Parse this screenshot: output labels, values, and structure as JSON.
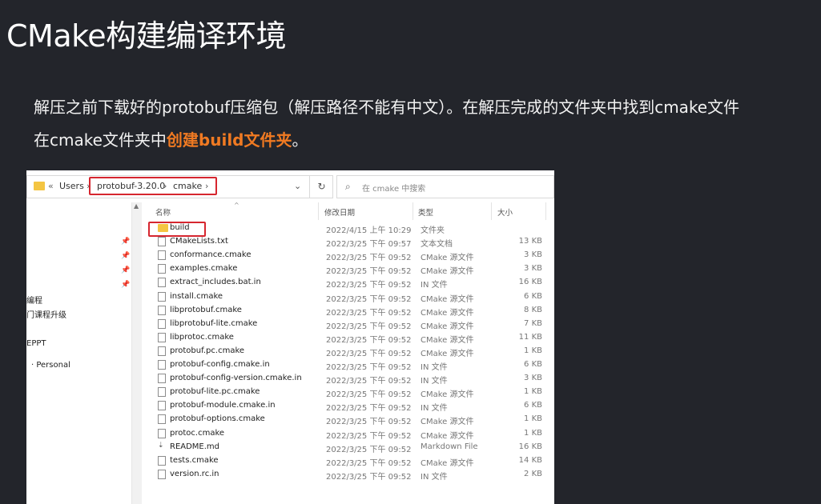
{
  "slide": {
    "title": "CMake构建编译环境",
    "line1": "解压之前下载好的protobuf压缩包（解压路径不能有中文）。在解压完成的文件夹中找到cmake文件",
    "line2_prefix": "在cmake文件夹中",
    "line2_highlight": "创建build文件夹",
    "line2_suffix": "。",
    "highlight_color": "#f07a22"
  },
  "explorer": {
    "address": {
      "prefix": "«",
      "users": "Users",
      "segment1": "protobuf-3.20.0",
      "segment2": "cmake",
      "chevron": "›",
      "dropdown": "⌄",
      "refresh": "↻"
    },
    "search": {
      "placeholder": "在 cmake 中搜索"
    },
    "nav": {
      "items": [
        "编程",
        "门课程升级",
        "EPPT",
        "· Personal"
      ]
    },
    "columns": {
      "name": "名称",
      "date": "修改日期",
      "type": "类型",
      "size": "大小"
    },
    "files": [
      {
        "name": "build",
        "date": "2022/4/15 上午 10:29",
        "type": "文件夹",
        "size": "",
        "icon": "folder-icon"
      },
      {
        "name": "CMakeLists.txt",
        "date": "2022/3/25 下午 09:57",
        "type": "文本文档",
        "size": "13 KB",
        "icon": "file-icon"
      },
      {
        "name": "conformance.cmake",
        "date": "2022/3/25 下午 09:52",
        "type": "CMake 源文件",
        "size": "3 KB",
        "icon": "file-icon"
      },
      {
        "name": "examples.cmake",
        "date": "2022/3/25 下午 09:52",
        "type": "CMake 源文件",
        "size": "3 KB",
        "icon": "file-icon"
      },
      {
        "name": "extract_includes.bat.in",
        "date": "2022/3/25 下午 09:52",
        "type": "IN 文件",
        "size": "16 KB",
        "icon": "file-icon"
      },
      {
        "name": "install.cmake",
        "date": "2022/3/25 下午 09:52",
        "type": "CMake 源文件",
        "size": "6 KB",
        "icon": "file-icon"
      },
      {
        "name": "libprotobuf.cmake",
        "date": "2022/3/25 下午 09:52",
        "type": "CMake 源文件",
        "size": "8 KB",
        "icon": "file-icon"
      },
      {
        "name": "libprotobuf-lite.cmake",
        "date": "2022/3/25 下午 09:52",
        "type": "CMake 源文件",
        "size": "7 KB",
        "icon": "file-icon"
      },
      {
        "name": "libprotoc.cmake",
        "date": "2022/3/25 下午 09:52",
        "type": "CMake 源文件",
        "size": "11 KB",
        "icon": "file-icon"
      },
      {
        "name": "protobuf.pc.cmake",
        "date": "2022/3/25 下午 09:52",
        "type": "CMake 源文件",
        "size": "1 KB",
        "icon": "file-icon"
      },
      {
        "name": "protobuf-config.cmake.in",
        "date": "2022/3/25 下午 09:52",
        "type": "IN 文件",
        "size": "6 KB",
        "icon": "file-icon"
      },
      {
        "name": "protobuf-config-version.cmake.in",
        "date": "2022/3/25 下午 09:52",
        "type": "IN 文件",
        "size": "3 KB",
        "icon": "file-icon"
      },
      {
        "name": "protobuf-lite.pc.cmake",
        "date": "2022/3/25 下午 09:52",
        "type": "CMake 源文件",
        "size": "1 KB",
        "icon": "file-icon"
      },
      {
        "name": "protobuf-module.cmake.in",
        "date": "2022/3/25 下午 09:52",
        "type": "IN 文件",
        "size": "6 KB",
        "icon": "file-icon"
      },
      {
        "name": "protobuf-options.cmake",
        "date": "2022/3/25 下午 09:52",
        "type": "CMake 源文件",
        "size": "1 KB",
        "icon": "file-icon"
      },
      {
        "name": "protoc.cmake",
        "date": "2022/3/25 下午 09:52",
        "type": "CMake 源文件",
        "size": "1 KB",
        "icon": "file-icon"
      },
      {
        "name": "README.md",
        "date": "2022/3/25 下午 09:52",
        "type": "Markdown File",
        "size": "16 KB",
        "icon": "markdown-icon"
      },
      {
        "name": "tests.cmake",
        "date": "2022/3/25 下午 09:52",
        "type": "CMake 源文件",
        "size": "14 KB",
        "icon": "file-icon"
      },
      {
        "name": "version.rc.in",
        "date": "2022/3/25 下午 09:52",
        "type": "IN 文件",
        "size": "2 KB",
        "icon": "file-icon"
      }
    ]
  }
}
